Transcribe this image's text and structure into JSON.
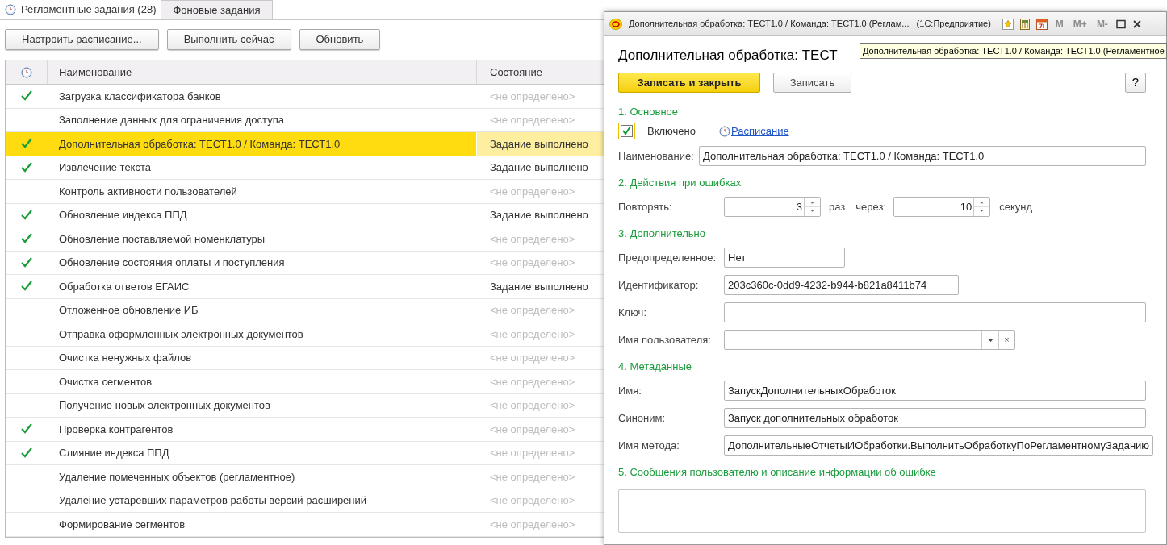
{
  "tabs": [
    {
      "label": "Регламентные задания (28)",
      "selected": true
    },
    {
      "label": "Фоновые задания",
      "selected": false
    }
  ],
  "toolbar": [
    "Настроить расписание...",
    "Выполнить сейчас",
    "Обновить"
  ],
  "table": {
    "columns": [
      "Наименование",
      "Состояние"
    ],
    "rows": [
      {
        "checked": true,
        "name": "Загрузка классификатора банков",
        "state": "<не определено>",
        "defined": false,
        "selected": false
      },
      {
        "checked": false,
        "name": "Заполнение данных для ограничения доступа",
        "state": "<не определено>",
        "defined": false,
        "selected": false
      },
      {
        "checked": true,
        "name": "Дополнительная обработка: ТЕСТ1.0 / Команда: ТЕСТ1.0",
        "state": "Задание выполнено",
        "defined": true,
        "selected": true
      },
      {
        "checked": true,
        "name": "Извлечение текста",
        "state": "Задание выполнено",
        "defined": true,
        "selected": false
      },
      {
        "checked": false,
        "name": "Контроль активности пользователей",
        "state": "<не определено>",
        "defined": false,
        "selected": false
      },
      {
        "checked": true,
        "name": "Обновление индекса ППД",
        "state": "Задание выполнено",
        "defined": true,
        "selected": false
      },
      {
        "checked": true,
        "name": "Обновление поставляемой номенклатуры",
        "state": "<не определено>",
        "defined": false,
        "selected": false
      },
      {
        "checked": true,
        "name": "Обновление состояния оплаты и поступления",
        "state": "<не определено>",
        "defined": false,
        "selected": false
      },
      {
        "checked": true,
        "name": "Обработка ответов ЕГАИС",
        "state": "Задание выполнено",
        "defined": true,
        "selected": false
      },
      {
        "checked": false,
        "name": "Отложенное обновление ИБ",
        "state": "<не определено>",
        "defined": false,
        "selected": false
      },
      {
        "checked": false,
        "name": "Отправка оформленных электронных документов",
        "state": "<не определено>",
        "defined": false,
        "selected": false
      },
      {
        "checked": false,
        "name": "Очистка ненужных файлов",
        "state": "<не определено>",
        "defined": false,
        "selected": false
      },
      {
        "checked": false,
        "name": "Очистка сегментов",
        "state": "<не определено>",
        "defined": false,
        "selected": false
      },
      {
        "checked": false,
        "name": "Получение новых электронных документов",
        "state": "<не определено>",
        "defined": false,
        "selected": false
      },
      {
        "checked": true,
        "name": "Проверка контрагентов",
        "state": "<не определено>",
        "defined": false,
        "selected": false
      },
      {
        "checked": true,
        "name": "Слияние индекса ППД",
        "state": "<не определено>",
        "defined": false,
        "selected": false
      },
      {
        "checked": false,
        "name": "Удаление помеченных объектов (регламентное)",
        "state": "<не определено>",
        "defined": false,
        "selected": false
      },
      {
        "checked": false,
        "name": "Удаление устаревших параметров работы версий расширений",
        "state": "<не определено>",
        "defined": false,
        "selected": false
      },
      {
        "checked": false,
        "name": "Формирование сегментов",
        "state": "<не определено>",
        "defined": false,
        "selected": false
      }
    ]
  },
  "dialog": {
    "title": "Дополнительная обработка: ТЕСТ1.0 / Команда: ТЕСТ1.0 (Реглам...   (1С:Предприятие)",
    "title_buttons": [
      "M",
      "M+",
      "M-"
    ],
    "heading": "Дополнительная обработка: ТЕСТ",
    "tooltip": "Дополнительная обработка: ТЕСТ1.0 / Команда: ТЕСТ1.0 (Регламентное",
    "buttons": [
      {
        "label": "Записать и закрыть",
        "kind": "primary"
      },
      {
        "label": "Записать",
        "kind": "normal"
      }
    ],
    "help": "?",
    "sections": [
      {
        "title": "1. Основное",
        "fields": [
          {
            "kind": "checkbox",
            "label": "Включено",
            "checked": true,
            "link": "Расписание"
          },
          {
            "kind": "wide",
            "label": "Наименование:",
            "value": "Дополнительная обработка: ТЕСТ1.0 / Команда: ТЕСТ1.0"
          }
        ]
      },
      {
        "title": "2. Действия при ошибках",
        "fields": [
          {
            "kind": "retry",
            "label": "Повторять:",
            "count": "3",
            "unit1": "раз",
            "label2": "через:",
            "interval": "10",
            "unit2": "секунд"
          }
        ]
      },
      {
        "title": "3. Дополнительно",
        "fields": [
          {
            "kind": "short",
            "label": "Предопределенное:",
            "value": "Нет"
          },
          {
            "kind": "medium",
            "label": "Идентификатор:",
            "value": "203c360c-0dd9-4232-b944-b821a8411b74"
          },
          {
            "kind": "text",
            "label": "Ключ:"
          },
          {
            "kind": "select",
            "label": "Имя пользователя:",
            "clear": "×"
          }
        ]
      },
      {
        "title": "4. Метаданные",
        "fields": [
          {
            "kind": "text",
            "label": "Имя:",
            "value": "ЗапускДополнительныхОбработок"
          },
          {
            "kind": "text",
            "label": "Синоним:",
            "value": "Запуск дополнительных обработок"
          },
          {
            "kind": "text",
            "label": "Имя метода:",
            "value": "ДополнительныеОтчетыИОбработки.ВыполнитьОбработкуПоРегламентномуЗаданию"
          }
        ]
      },
      {
        "title": "5. Сообщения пользователю и описание информации об ошибке",
        "fields": [
          {
            "kind": "memo"
          }
        ]
      }
    ]
  }
}
